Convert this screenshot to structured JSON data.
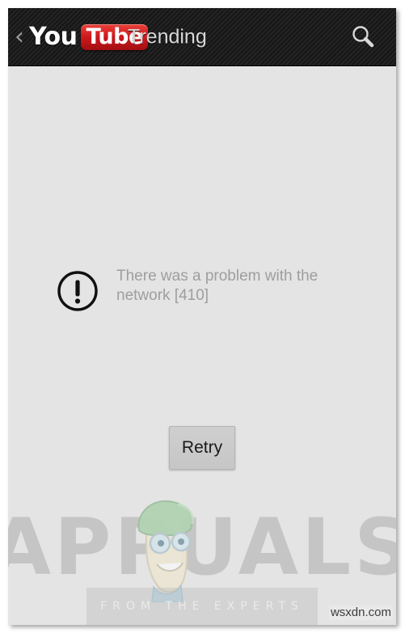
{
  "app": {
    "name": "YouTube",
    "platform": "Android"
  },
  "action_bar": {
    "back_icon": "back-chevron-icon",
    "logo_you": "You",
    "logo_tube": "Tube",
    "title": "Trending",
    "search_icon": "search-icon",
    "background_color": "#1e1e1e",
    "title_color": "#d8d8d8",
    "logo_red": "#cc181e"
  },
  "content": {
    "background_color": "#e4e4e4",
    "error": {
      "icon": "exclamation-circle-icon",
      "message": "There was a problem with the network [410]",
      "text_color": "#9e9e9e"
    },
    "retry_button": {
      "label": "Retry",
      "fill_color": "#c8c8c8",
      "text_color": "#1a1a1a"
    }
  },
  "watermark": {
    "brand": "APPUALS",
    "tagline": "FROM THE EXPERTS",
    "mascot": "cartoon-face-with-green-beret",
    "brand_color": "#b0b0b0"
  },
  "site_watermark": {
    "text": "wsxdn.com"
  }
}
